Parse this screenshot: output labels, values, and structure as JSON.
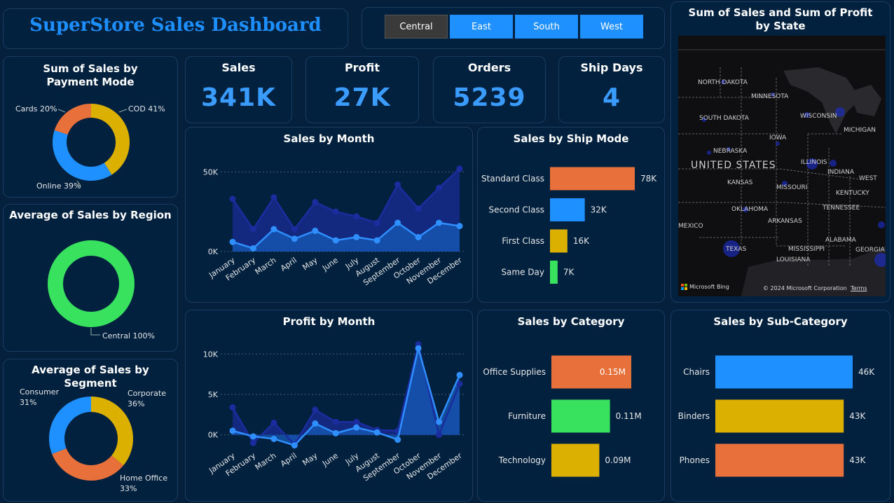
{
  "header": {
    "title": "SuperStore Sales Dashboard"
  },
  "region_slicer": {
    "options": [
      "Central",
      "East",
      "South",
      "West"
    ],
    "selected": "Central"
  },
  "kpis": {
    "sales": {
      "label": "Sales",
      "value": "341K"
    },
    "profit": {
      "label": "Profit",
      "value": "27K"
    },
    "orders": {
      "label": "Orders",
      "value": "5239"
    },
    "ship_days": {
      "label": "Ship Days",
      "value": "4"
    }
  },
  "payment_mode": {
    "title": "Sum of Sales by Payment Mode"
  },
  "region_avg": {
    "title": "Average of Sales by Region"
  },
  "segment_avg": {
    "title": "Average of Sales by Segment"
  },
  "sales_by_month": {
    "title": "Sales by Month"
  },
  "profit_by_month": {
    "title": "Profit by Month"
  },
  "ship_mode": {
    "title": "Sales by Ship Mode"
  },
  "category": {
    "title": "Sales by Category"
  },
  "subcategory": {
    "title": "Sales by Sub-Category"
  },
  "map": {
    "title": "Sum of Sales and Sum of Profit by State",
    "country_label": "UNITED STATES",
    "state_labels": [
      "NORTH DAKOTA",
      "MINNESOTA",
      "WISCONSIN",
      "MICHIGAN",
      "SOUTH DAKOTA",
      "IOWA",
      "NEBRASKA",
      "ILLINOIS",
      "INDIANA",
      "UNITED STATES",
      "KANSAS",
      "MISSOURI",
      "KENTUCKY",
      "WEST",
      "OKLAHOMA",
      "TENNESSEE",
      "ARKANSAS",
      "MEXICO",
      "ALABAMA",
      "GEORGIA",
      "MISSISSIPPI",
      "TEXAS",
      "LOUISIANA"
    ],
    "bing_label": "Microsoft Bing",
    "copyright": "© 2024 Microsoft Corporation",
    "terms": "Terms"
  },
  "colors": {
    "blue": "#1e90ff",
    "gold": "#dbb000",
    "orange": "#e8703a",
    "green": "#38e25f",
    "dark_line": "#1b2c9e",
    "light_line": "#2f8fff"
  },
  "chart_data": [
    {
      "id": "payment-mode-donut",
      "type": "pie",
      "title": "Sum of Sales by Payment Mode",
      "categories": [
        "COD",
        "Online",
        "Cards"
      ],
      "values": [
        41,
        39,
        20
      ],
      "labels": [
        "COD 41%",
        "Online 39%",
        "Cards 20%"
      ],
      "colors": [
        "#dbb000",
        "#1e90ff",
        "#e8703a"
      ]
    },
    {
      "id": "region-donut",
      "type": "pie",
      "title": "Average of Sales by Region",
      "categories": [
        "Central"
      ],
      "values": [
        100
      ],
      "labels": [
        "Central 100%"
      ],
      "colors": [
        "#38e25f"
      ]
    },
    {
      "id": "segment-donut",
      "type": "pie",
      "title": "Average of Sales by Segment",
      "categories": [
        "Corporate",
        "Home Office",
        "Consumer"
      ],
      "values": [
        36,
        33,
        31
      ],
      "labels": [
        "Corporate 36%",
        "Home Office 33%",
        "Consumer 31%"
      ],
      "colors": [
        "#dbb000",
        "#e8703a",
        "#1e90ff"
      ]
    },
    {
      "id": "sales-by-month",
      "type": "area",
      "title": "Sales by Month",
      "categories": [
        "January",
        "February",
        "March",
        "April",
        "May",
        "June",
        "July",
        "August",
        "September",
        "October",
        "November",
        "December"
      ],
      "series": [
        {
          "values": [
            33,
            14,
            34,
            14,
            31,
            25,
            22,
            18,
            42,
            27,
            40,
            52
          ]
        },
        {
          "values": [
            6,
            2,
            14,
            8,
            13,
            7,
            9,
            7,
            18,
            9,
            18,
            16
          ]
        }
      ],
      "yticks": [
        "0K",
        "50K"
      ],
      "ylim": [
        0,
        55
      ]
    },
    {
      "id": "profit-by-month",
      "type": "area",
      "title": "Profit by Month",
      "categories": [
        "January",
        "February",
        "March",
        "April",
        "May",
        "June",
        "July",
        "August",
        "September",
        "October",
        "November",
        "December"
      ],
      "series": [
        {
          "values": [
            3.4,
            -1.0,
            1.5,
            -1.2,
            3.1,
            1.6,
            1.6,
            0.6,
            0.5,
            11.2,
            0.0,
            6.3
          ]
        },
        {
          "values": [
            0.5,
            -0.2,
            -0.5,
            -1.3,
            1.4,
            0.2,
            0.9,
            0.3,
            -0.6,
            10.7,
            1.6,
            7.4
          ]
        }
      ],
      "yticks": [
        "0K",
        "5K",
        "10K"
      ],
      "ylim": [
        -1.5,
        11.5
      ]
    },
    {
      "id": "ship-mode",
      "type": "bar",
      "title": "Sales by Ship Mode",
      "categories": [
        "Standard Class",
        "Second Class",
        "First Class",
        "Same Day"
      ],
      "values": [
        78,
        32,
        16,
        7
      ],
      "labels": [
        "78K",
        "32K",
        "16K",
        "7K"
      ],
      "colors": [
        "#e8703a",
        "#1e90ff",
        "#dbb000",
        "#38e25f"
      ]
    },
    {
      "id": "category",
      "type": "bar",
      "title": "Sales by Category",
      "categories": [
        "Office Supplies",
        "Furniture",
        "Technology"
      ],
      "values": [
        0.15,
        0.11,
        0.09
      ],
      "labels": [
        "0.15M",
        "0.11M",
        "0.09M"
      ],
      "colors": [
        "#e8703a",
        "#38e25f",
        "#dbb000"
      ]
    },
    {
      "id": "subcategory",
      "type": "bar",
      "title": "Sales by Sub-Category",
      "categories": [
        "Chairs",
        "Binders",
        "Phones"
      ],
      "values": [
        46,
        43,
        43
      ],
      "labels": [
        "46K",
        "43K",
        "43K"
      ],
      "colors": [
        "#1e90ff",
        "#dbb000",
        "#e8703a"
      ]
    }
  ]
}
